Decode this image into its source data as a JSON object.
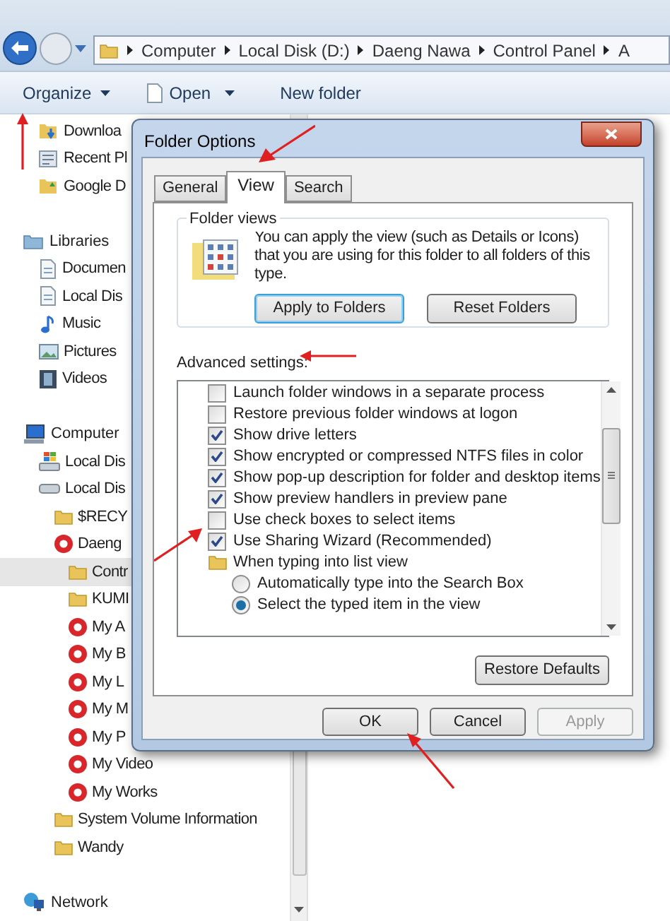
{
  "address_bar": {
    "crumbs": [
      "Computer",
      "Local Disk (D:)",
      "Daeng Nawa",
      "Control Panel",
      "A"
    ]
  },
  "toolbar": {
    "items": [
      {
        "label": "Organize",
        "kind": "menu"
      },
      {
        "label": "Open",
        "kind": "open"
      },
      {
        "label": "New folder",
        "kind": "plain"
      }
    ]
  },
  "sidebar": {
    "groups": [
      {
        "items": [
          {
            "label": "Downloa",
            "kind": "download",
            "selected": false
          },
          {
            "label": "Recent Pl",
            "kind": "recent",
            "selected": false
          },
          {
            "label": "Google D",
            "kind": "drive-folder",
            "selected": false
          }
        ]
      },
      {
        "label": "Libraries",
        "kind": "libraries",
        "items": [
          {
            "label": "Documen",
            "kind": "document",
            "selected": false
          },
          {
            "label": "Local Dis",
            "kind": "document",
            "selected": false
          },
          {
            "label": "Music",
            "kind": "music",
            "selected": false
          },
          {
            "label": "Pictures",
            "kind": "pictures",
            "selected": false
          },
          {
            "label": "Videos",
            "kind": "video",
            "selected": false
          }
        ]
      },
      {
        "label": "Computer",
        "kind": "computer",
        "items": [
          {
            "label": "Local Dis",
            "kind": "windows-drive",
            "selected": false
          },
          {
            "label": "Local Dis",
            "kind": "drive",
            "selected": false,
            "children": [
              {
                "label": "$RECY",
                "kind": "folder",
                "selected": false
              },
              {
                "label": "Daeng",
                "kind": "badge",
                "selected": false,
                "children": [
                  {
                    "label": "Contr",
                    "kind": "folder",
                    "selected": true
                  },
                  {
                    "label": "KUMI",
                    "kind": "folder",
                    "selected": false
                  },
                  {
                    "label": "My A",
                    "kind": "badge",
                    "selected": false
                  },
                  {
                    "label": "My B",
                    "kind": "badge",
                    "selected": false
                  },
                  {
                    "label": "My L",
                    "kind": "badge",
                    "selected": false
                  },
                  {
                    "label": "My M",
                    "kind": "badge",
                    "selected": false
                  },
                  {
                    "label": "My P",
                    "kind": "badge",
                    "selected": false
                  },
                  {
                    "label": "My Video",
                    "kind": "badge",
                    "selected": false
                  },
                  {
                    "label": "My Works",
                    "kind": "badge",
                    "selected": false
                  }
                ]
              },
              {
                "label": "System Volume Information",
                "kind": "folder",
                "selected": false
              },
              {
                "label": "Wandy",
                "kind": "folder",
                "selected": false
              }
            ]
          }
        ]
      },
      {
        "label": "Network",
        "kind": "network"
      }
    ]
  },
  "dialog": {
    "title": "Folder Options",
    "tabs": [
      {
        "label": "General",
        "selected": false
      },
      {
        "label": "View",
        "selected": true
      },
      {
        "label": "Search",
        "selected": false
      }
    ],
    "folder_views": {
      "title": "Folder views",
      "text": "You can apply the view (such as Details or Icons) that you are using for this folder to all folders of this type.",
      "buttons": [
        {
          "label": "Apply to Folders",
          "default": true
        },
        {
          "label": "Reset Folders",
          "default": false
        }
      ]
    },
    "advanced_label": "Advanced settings:",
    "settings": [
      {
        "kind": "checkbox",
        "label": "Launch folder windows in a separate process",
        "checked": false
      },
      {
        "kind": "checkbox",
        "label": "Restore previous folder windows at logon",
        "checked": false
      },
      {
        "kind": "checkbox",
        "label": "Show drive letters",
        "checked": true
      },
      {
        "kind": "checkbox",
        "label": "Show encrypted or compressed NTFS files in color",
        "checked": true
      },
      {
        "kind": "checkbox",
        "label": "Show pop-up description for folder and desktop items",
        "checked": true
      },
      {
        "kind": "checkbox",
        "label": "Show preview handlers in preview pane",
        "checked": true
      },
      {
        "kind": "checkbox",
        "label": "Use check boxes to select items",
        "checked": false
      },
      {
        "kind": "checkbox",
        "label": "Use Sharing Wizard (Recommended)",
        "checked": true
      },
      {
        "kind": "folder",
        "label": "When typing into list view"
      },
      {
        "kind": "radio",
        "label": "Automatically type into the Search Box",
        "selected": false
      },
      {
        "kind": "radio",
        "label": "Select the typed item in the view",
        "selected": true
      }
    ],
    "restore_button": "Restore Defaults",
    "buttons": [
      {
        "label": "OK",
        "disabled": false
      },
      {
        "label": "Cancel",
        "disabled": false
      },
      {
        "label": "Apply",
        "disabled": true
      }
    ]
  }
}
